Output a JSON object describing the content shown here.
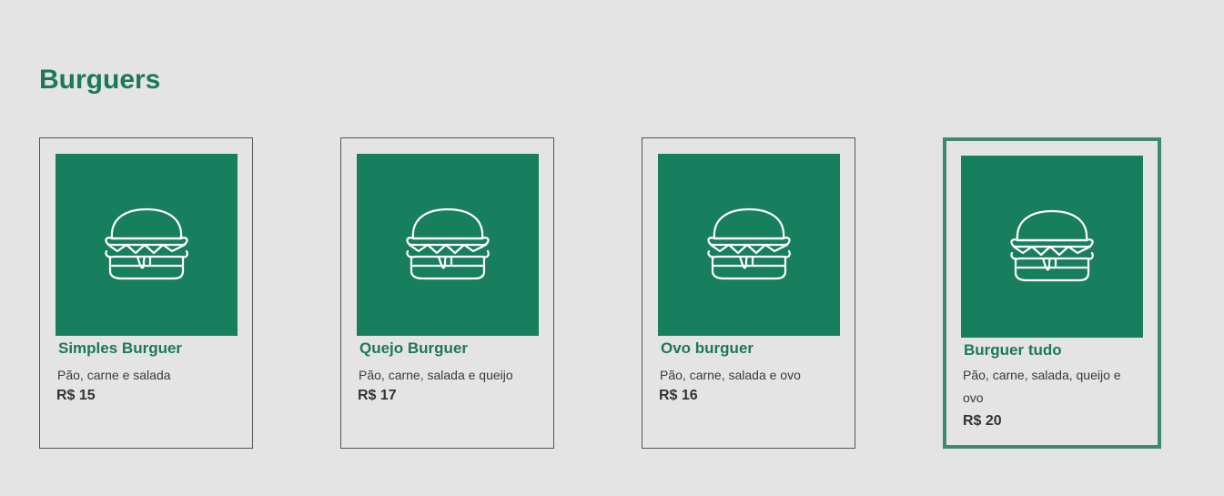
{
  "section": {
    "title": "Burguers"
  },
  "products": [
    {
      "name": "Simples Burguer",
      "description": "Pão, carne e salada",
      "price": "R$ 15",
      "icon": "burger-icon"
    },
    {
      "name": "Quejo Burguer",
      "description": "Pão, carne, salada e queijo",
      "price": "R$ 17",
      "icon": "burger-icon"
    },
    {
      "name": "Ovo burguer",
      "description": "Pão, carne, salada e ovo",
      "price": "R$ 16",
      "icon": "burger-icon"
    },
    {
      "name": "Burguer tudo",
      "description": "Pão, carne, salada, queijo e ovo",
      "price": "R$ 20",
      "icon": "burger-icon",
      "highlighted": true
    }
  ],
  "colors": {
    "background": "#e4e4e4",
    "brand_green": "#177f5d",
    "title_green": "#1b7a55",
    "highlight_border": "#3d8a6c"
  }
}
